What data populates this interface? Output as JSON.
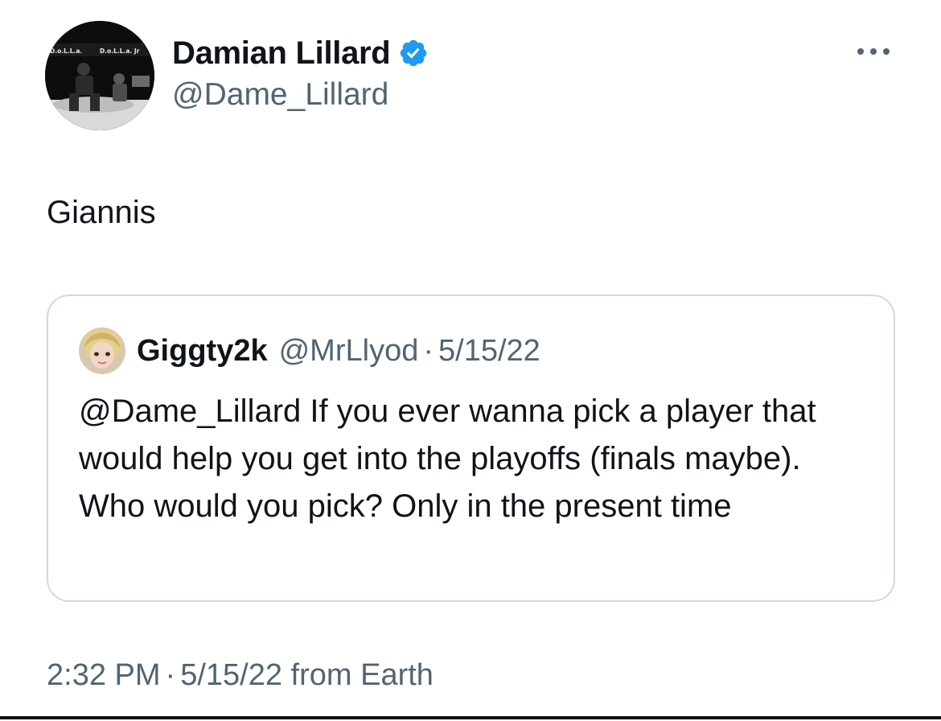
{
  "author": {
    "display_name": "Damian Lillard",
    "handle": "@Dame_Lillard",
    "verified": true,
    "avatar_texts": [
      "D.o.L.L.a.",
      "D.o.L.L.a. Jr"
    ]
  },
  "tweet": {
    "text": "Giannis"
  },
  "quoted_tweet": {
    "display_name": "Giggty2k",
    "handle": "@MrLlyod",
    "separator": "·",
    "date": "5/15/22",
    "text": "@Dame_Lillard If you ever wanna pick a player that would help you get into the playoffs (finals maybe). Who would you pick? Only in the present time"
  },
  "meta": {
    "time": "2:32 PM",
    "separator": "·",
    "date": "5/15/22",
    "source": "from Earth"
  },
  "icons": {
    "verified": "verified-badge-icon",
    "more": "more-options-icon"
  },
  "colors": {
    "primary_text": "#0f1419",
    "secondary_text": "#536471",
    "verified_blue": "#1d9bf0",
    "border": "#cfd9de"
  }
}
